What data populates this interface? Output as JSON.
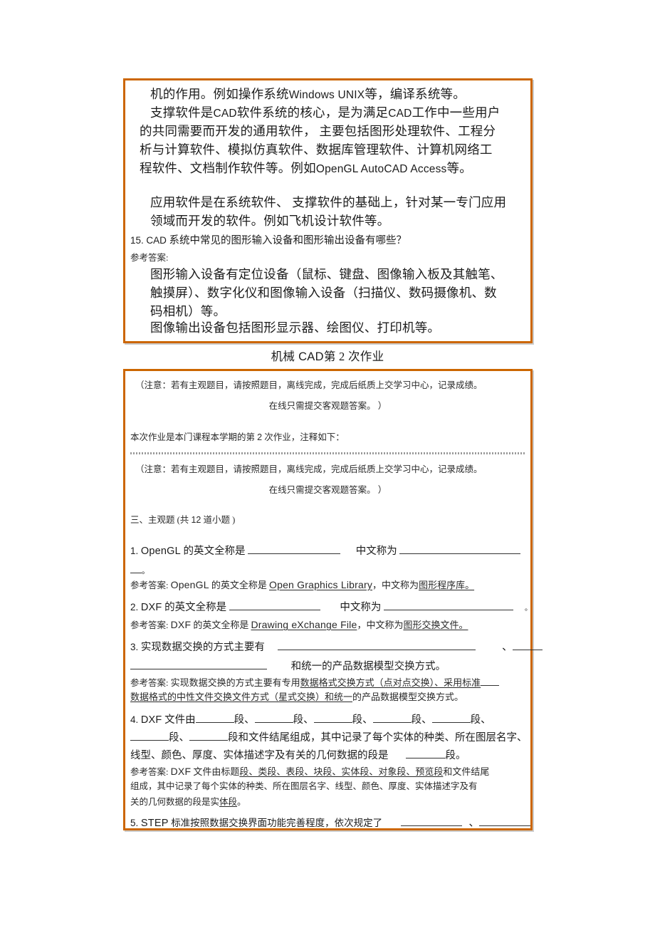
{
  "document": {
    "assignment_title_cn": "机械",
    "assignment_title_mid": "CAD",
    "assignment_title_rest": "第 2 次作业"
  },
  "box_top": {
    "paragraph_1": {
      "l1_a": "机的作用。例如操作系统",
      "l1_b": "Windows  UNIX",
      "l1_c": "等，编译系统等。",
      "l2_a": "支撑软件是",
      "l2_b": "CAD",
      "l2_c": "软件系统的核心，",
      "l2_d": "是为满足",
      "l2_e": "CAD",
      "l2_f": "工作中一些用户",
      "l3": "的共同需要而开发的通用软件，    主要包括图形处理软件、工程分",
      "l4": "析与计算软件、模拟仿真软件、数据库管理软件、计算机网络工",
      "l5_a": "程软件、文档制作软件等。例如",
      "l5_b": "OpenGL AutoCAD  Access",
      "l5_c": "等。"
    },
    "paragraph_2": {
      "l1": "应用软件是在系统软件、  支撑软件的基础上，针对某一专门应用",
      "l2": "领域而开发的软件。例如飞机设计软件等。"
    },
    "question_15": {
      "number": "15.",
      "acronym": "CAD",
      "text": "系统中常见的图形输入设备和图形输出设备有哪些？",
      "answer_label": "参考答案:",
      "answer_l1": "图形输入设备有定位设备（鼠标、键盘、图像输入板及其触笔、",
      "answer_l2": "触摸屏）、数字化仪和图像输入设备（扫描仪、数码摄像机、数",
      "answer_l3": "码相机）等。",
      "answer_l4": "图像输出设备包括图形显示器、绘图仪、打印机等。"
    }
  },
  "box_main": {
    "notice_1": {
      "line_1": "（注意：若有主观题目，请按照题目，离线完成，完成后纸质上交学习中心，记录成绩。",
      "line_2": "在线只需提交客观题答案。    ）"
    },
    "intro": {
      "prefix": "本次作业是本门课程本学期的第",
      "count": "2",
      "suffix": "次作业，注释如下："
    },
    "notice_2": {
      "line_1": "（注意：若有主观题目，请按照题目，离线完成，完成后纸质上交学习中心，记录成绩。",
      "line_2": "在线只需提交客观题答案。    ）"
    },
    "section_heading": {
      "prefix": "三、主观题",
      "count_open": "(共",
      "count": "12",
      "count_close": "道小题 )"
    },
    "questions": [
      {
        "number": "1.",
        "acronym": "OpenGL",
        "stem_a": "的英文全称是",
        "stem_b": "中文称为",
        "stem_c": "。",
        "answer_label": "参考答案:",
        "answer_acronym": "OpenGL",
        "answer_a": "的英文全称是",
        "answer_fill": "Open  Graphics  Library",
        "answer_b": "，中文称为",
        "answer_fill2": "图形程序库。"
      },
      {
        "number": "2.",
        "acronym": "DXF",
        "stem_a": "的英文全称是",
        "stem_b": "中文称为",
        "stem_c": "。",
        "answer_label": "参考答案:",
        "answer_acronym": "DXF",
        "answer_a": "的英文全称是",
        "answer_fill": "Drawing  eXchange  File",
        "answer_b": "，中文称为",
        "answer_fill2": "图形交换文件。"
      },
      {
        "number": "3.",
        "stem_a": "实现数据交换的方式主要有",
        "stem_b": "、",
        "stem_c": "和统一的产品数据模型交换方式。",
        "answer_label": "参考答案:",
        "answer_l1_plain": "实现数据交换的方式主要有专用",
        "answer_l1_u": "数据格式交换方式（点对点交换）、采用标准",
        "answer_l2_u": "数据格式的中性文件交换文件方式（星式交换）和统一",
        "answer_l2_plain": "的产品数据模型交换方式。"
      },
      {
        "number": "4.",
        "acronym": "DXF",
        "stem_a": "文件由",
        "seg": "段、",
        "stem_b": "段和文件结尾组成，其中记录了每个实体的种类、所在图层名字、",
        "stem_c": "线型、颜色、厚度、实体描述字及有关的几何数据的段是",
        "stem_d": "段。",
        "answer_label": "参考答案:",
        "answer_acronym": "DXF",
        "answer_l1_a": "文件由标题",
        "answer_l1_parts": "段、类段、表段、块段、实体段、对象段、预览段",
        "answer_l1_b": "和文件结尾",
        "answer_l2": "组成，其中记录了每个实体的种类、所在图层名字、线型、颜色、厚度、实体描述字及有",
        "answer_l3_a": "关的几何数据的段是实",
        "answer_l3_u": "体段",
        "answer_l3_b": "。"
      },
      {
        "number": "5.",
        "acronym": "STEP",
        "stem_a": "标准按照数据交换界面功能完善程度，依次规定了",
        "stem_b": "、"
      }
    ]
  },
  "colors": {
    "box_border": "#cc6600",
    "box_shadow": "#cccccc",
    "rule": "#9a9a9a",
    "text": "#1c1c1c"
  }
}
